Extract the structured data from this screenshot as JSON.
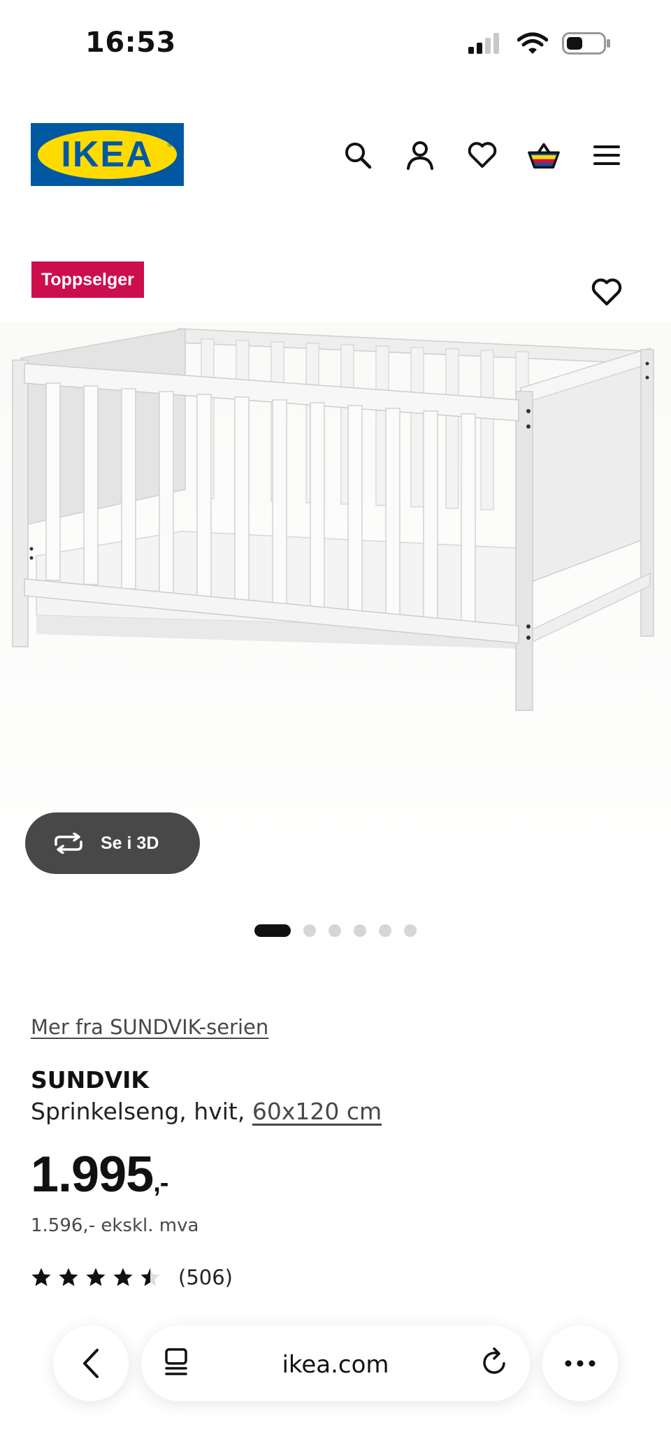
{
  "status_bar": {
    "time": "16:53"
  },
  "header": {
    "logo_text": "IKEA",
    "icons": [
      "search-icon",
      "user-icon",
      "heart-icon",
      "basket-icon",
      "menu-icon"
    ]
  },
  "product": {
    "badge": "Toppselger",
    "view_3d_label": "Se i 3D",
    "image_count": 6,
    "active_image": 1,
    "series_link": "Mer fra SUNDVIK-serien",
    "name": "SUNDVIK",
    "description": "Sprinkelseng, hvit,",
    "size_link": "60x120 cm",
    "price": "1.995",
    "price_suffix": ",-",
    "price_ex_vat": "1.596,- ekskl. mva",
    "rating": 4.5,
    "rating_max": 5,
    "review_count": "(506)"
  },
  "browser": {
    "url": "ikea.com"
  },
  "colors": {
    "badge": "#cc0f4c",
    "logo_blue": "#0058a3",
    "logo_yellow": "#ffdb00",
    "button_3d": "#484848"
  }
}
